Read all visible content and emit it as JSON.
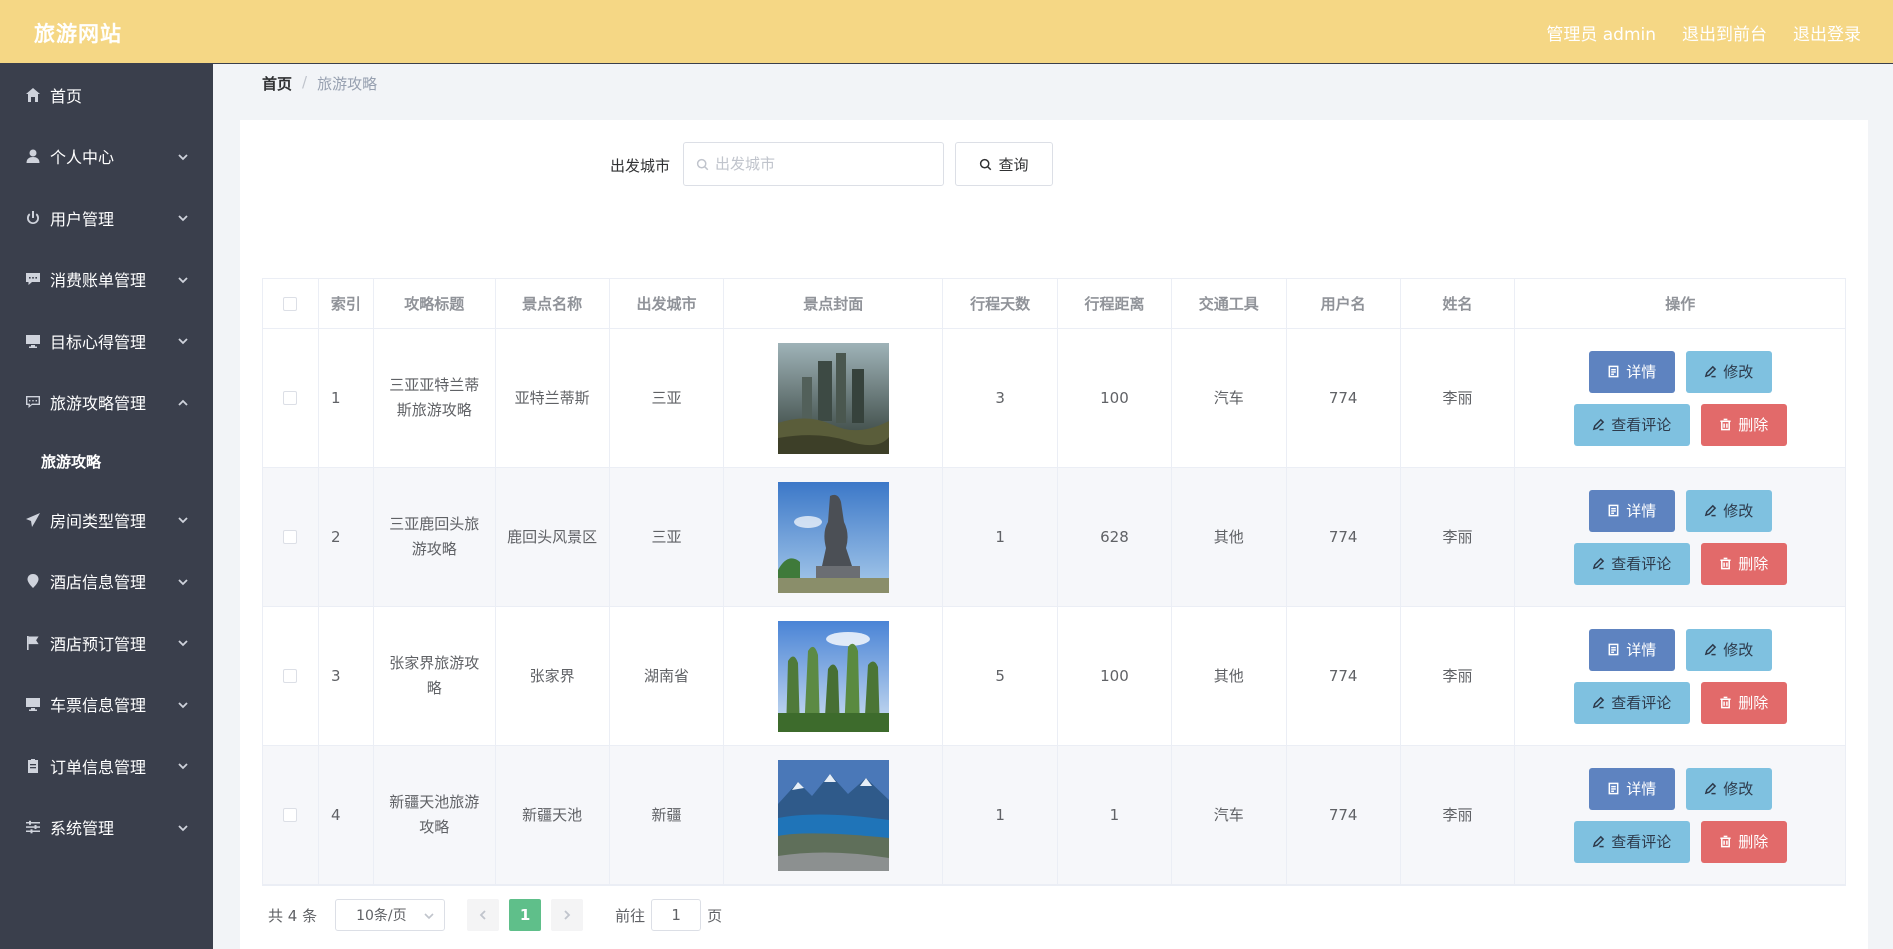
{
  "header": {
    "brand": "旅游网站",
    "admin_label": "管理员 admin",
    "to_front": "退出到前台",
    "logout": "退出登录"
  },
  "sidebar": {
    "items": [
      {
        "label": "首页",
        "icon": "home-icon",
        "chevron": ""
      },
      {
        "label": "个人中心",
        "icon": "user-icon",
        "chevron": "down"
      },
      {
        "label": "用户管理",
        "icon": "power-icon",
        "chevron": "down"
      },
      {
        "label": "消费账单管理",
        "icon": "message-icon",
        "chevron": "down"
      },
      {
        "label": "目标心得管理",
        "icon": "monitor-icon",
        "chevron": "down"
      },
      {
        "label": "旅游攻略管理",
        "icon": "chat-icon",
        "chevron": "up"
      }
    ],
    "subitem": "旅游攻略",
    "items2": [
      {
        "label": "房间类型管理",
        "icon": "send-icon",
        "chevron": "down"
      },
      {
        "label": "酒店信息管理",
        "icon": "map-pin-icon",
        "chevron": "down"
      },
      {
        "label": "酒店预订管理",
        "icon": "flag-icon",
        "chevron": "down"
      },
      {
        "label": "车票信息管理",
        "icon": "monitor-icon",
        "chevron": "down"
      },
      {
        "label": "订单信息管理",
        "icon": "clipboard-icon",
        "chevron": "down"
      },
      {
        "label": "系统管理",
        "icon": "sliders-icon",
        "chevron": "down"
      }
    ]
  },
  "breadcrumb": {
    "home": "首页",
    "separator": "/",
    "current": "旅游攻略"
  },
  "search": {
    "label": "出发城市",
    "placeholder": "出发城市",
    "button": "查询"
  },
  "table": {
    "headers": [
      "",
      "索引",
      "攻略标题",
      "景点名称",
      "出发城市",
      "景点封面",
      "行程天数",
      "行程距离",
      "交通工具",
      "用户名",
      "姓名",
      "操作"
    ],
    "rows": [
      {
        "index": "1",
        "title": "三亚亚特兰蒂斯旅游攻略",
        "spot": "亚特兰蒂斯",
        "city": "三亚",
        "days": "3",
        "distance": "100",
        "transport": "汽车",
        "username": "774",
        "name": "李丽",
        "cover": "atlantis"
      },
      {
        "index": "2",
        "title": "三亚鹿回头旅游攻略",
        "spot": "鹿回头风景区",
        "city": "三亚",
        "days": "1",
        "distance": "628",
        "transport": "其他",
        "username": "774",
        "name": "李丽",
        "cover": "statue"
      },
      {
        "index": "3",
        "title": "张家界旅游攻略",
        "spot": "张家界",
        "city": "湖南省",
        "days": "5",
        "distance": "100",
        "transport": "其他",
        "username": "774",
        "name": "李丽",
        "cover": "mountains"
      },
      {
        "index": "4",
        "title": "新疆天池旅游攻略",
        "spot": "新疆天池",
        "city": "新疆",
        "days": "1",
        "distance": "1",
        "transport": "汽车",
        "username": "774",
        "name": "李丽",
        "cover": "lake"
      }
    ],
    "actions": {
      "detail": "详情",
      "edit": "修改",
      "review": "查看评论",
      "delete": "删除"
    }
  },
  "pagination": {
    "total": "共 4 条",
    "page_size": "10条/页",
    "current_page": "1",
    "goto_prefix": "前往",
    "goto_value": "1",
    "goto_suffix": "页"
  },
  "colors": {
    "header_bg": "#f5d785",
    "sidebar_bg": "#3a3f4c",
    "primary": "#5e83c0",
    "info": "#7fc1e0",
    "danger": "#e26a6a",
    "pager_active": "#5fbf8a"
  }
}
